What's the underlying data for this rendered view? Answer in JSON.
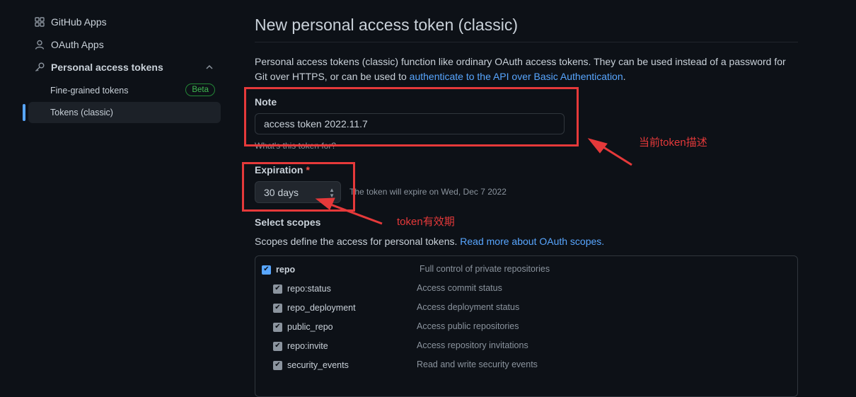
{
  "sidebar": {
    "items": [
      {
        "label": "GitHub Apps",
        "icon": "apps-grid-icon"
      },
      {
        "label": "OAuth Apps",
        "icon": "person-icon"
      },
      {
        "label": "Personal access tokens",
        "icon": "key-icon"
      }
    ],
    "sub_items": [
      {
        "label": "Fine-grained tokens",
        "badge": "Beta"
      },
      {
        "label": "Tokens (classic)",
        "active": true
      }
    ]
  },
  "page": {
    "title": "New personal access token (classic)",
    "desc_prefix": "Personal access tokens (classic) function like ordinary OAuth access tokens. They can be used instead of a password for Git over HTTPS, or can be used to ",
    "desc_link": "authenticate to the API over Basic Authentication",
    "desc_suffix": "."
  },
  "note": {
    "label": "Note",
    "value": "access token 2022.11.7",
    "hint": "What's this token for?"
  },
  "expiration": {
    "label": "Expiration",
    "required_mark": "*",
    "selected": "30 days",
    "note": "The token will expire on Wed, Dec 7 2022"
  },
  "scopes": {
    "title": "Select scopes",
    "desc": "Scopes define the access for personal tokens. ",
    "desc_link": "Read more about OAuth scopes.",
    "rows": [
      {
        "name": "repo",
        "desc": "Full control of private repositories",
        "checked": true
      },
      {
        "name": "repo:status",
        "desc": "Access commit status",
        "checked": true
      },
      {
        "name": "repo_deployment",
        "desc": "Access deployment status",
        "checked": true
      },
      {
        "name": "public_repo",
        "desc": "Access public repositories",
        "checked": true
      },
      {
        "name": "repo:invite",
        "desc": "Access repository invitations",
        "checked": true
      },
      {
        "name": "security_events",
        "desc": "Read and write security events",
        "checked": true
      }
    ]
  },
  "annotations": {
    "note_desc": "当前token描述",
    "expiry_desc": "token有效期",
    "color": "#e5393a"
  },
  "colors": {
    "background": "#0d1117",
    "link": "#58a6ff",
    "badge": "#3fb950"
  }
}
